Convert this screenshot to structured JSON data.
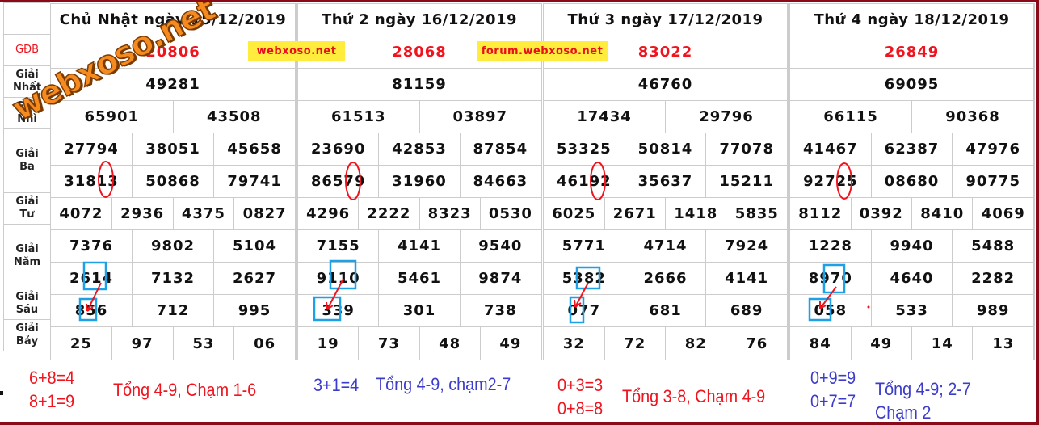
{
  "labels": {
    "gdb": "GĐB",
    "nhat": [
      "Giải",
      "Nhất"
    ],
    "nhi": [
      "Giải",
      "Nhì"
    ],
    "ba": [
      "Giải",
      "Ba"
    ],
    "tu": [
      "Giải",
      "Tư"
    ],
    "nam": [
      "Giải",
      "Năm"
    ],
    "sau": [
      "Giải",
      "Sáu"
    ],
    "bay": [
      "Giải",
      "Bảy"
    ]
  },
  "watermark": "webxoso.net",
  "ads": [
    "webxoso.net",
    "forum.webxoso.net"
  ],
  "days": [
    {
      "title": "Chủ Nhật ngày 15/12/2019",
      "db": "20806",
      "nhat": "49281",
      "nhi": [
        "65901",
        "43508"
      ],
      "ba": [
        "27794",
        "38051",
        "45658",
        "31813",
        "50868",
        "79741"
      ],
      "tu": [
        "4072",
        "2936",
        "4375",
        "0827"
      ],
      "nam": [
        "7376",
        "9802",
        "5104",
        "2614",
        "7132",
        "2627"
      ],
      "sau": [
        "856",
        "712",
        "995"
      ],
      "bay": [
        "25",
        "97",
        "53",
        "06"
      ]
    },
    {
      "title": "Thứ 2 ngày 16/12/2019",
      "db": "28068",
      "nhat": "81159",
      "nhi": [
        "61513",
        "03897"
      ],
      "ba": [
        "23690",
        "42853",
        "87854",
        "86579",
        "31960",
        "84663"
      ],
      "tu": [
        "4296",
        "2222",
        "8323",
        "0530"
      ],
      "nam": [
        "7155",
        "4141",
        "9540",
        "9110",
        "5461",
        "9874"
      ],
      "sau": [
        "339",
        "301",
        "738"
      ],
      "bay": [
        "19",
        "73",
        "48",
        "49"
      ]
    },
    {
      "title": "Thứ 3 ngày 17/12/2019",
      "db": "83022",
      "nhat": "46760",
      "nhi": [
        "17434",
        "29796"
      ],
      "ba": [
        "53325",
        "50814",
        "77078",
        "46192",
        "35637",
        "15211"
      ],
      "tu": [
        "6025",
        "2671",
        "1418",
        "5835"
      ],
      "nam": [
        "5771",
        "4714",
        "7924",
        "5382",
        "2666",
        "4141"
      ],
      "sau": [
        "077",
        "681",
        "689"
      ],
      "bay": [
        "32",
        "72",
        "82",
        "76"
      ]
    },
    {
      "title": "Thứ 4 ngày 18/12/2019",
      "db": "26849",
      "nhat": "69095",
      "nhi": [
        "66115",
        "90368"
      ],
      "ba": [
        "41467",
        "62387",
        "47976",
        "92725",
        "08680",
        "90775"
      ],
      "tu": [
        "8112",
        "0392",
        "8410",
        "4069"
      ],
      "nam": [
        "1228",
        "9940",
        "5488",
        "8970",
        "4640",
        "2282"
      ],
      "sau": [
        "058",
        "533",
        "989"
      ],
      "bay": [
        "84",
        "49",
        "14",
        "13"
      ]
    }
  ],
  "notes": [
    {
      "lines": [
        "6+8=4",
        "8+1=9"
      ],
      "summary": "Tổng 4-9, Chạm 1-6",
      "color": "#f0141e"
    },
    {
      "lines": [
        "3+1=4"
      ],
      "summary": "Tổng 4-9, chạm2-7",
      "color": "#3c3ccc"
    },
    {
      "lines": [
        "0+3=3",
        "0+8=8"
      ],
      "summary": "Tổng 3-8, Chạm 4-9",
      "color": "#f0141e"
    },
    {
      "lines": [
        "0+9=9",
        "0+7=7"
      ],
      "summary": "Tổng 4-9; 2-7",
      "summary2": "Chạm 2",
      "color": "#3c3ccc"
    }
  ],
  "colors": {
    "border": "#8b0a1a",
    "db": "#f0141e",
    "ad_bg": "#ffec3d",
    "mark_red": "#f0141e",
    "mark_blue": "#1ea0e6"
  }
}
